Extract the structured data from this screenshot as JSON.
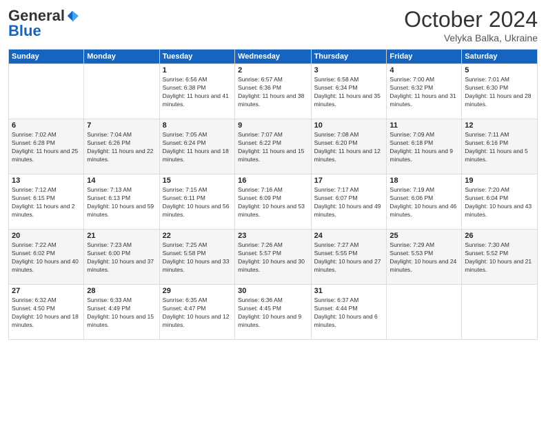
{
  "logo": {
    "general": "General",
    "blue": "Blue"
  },
  "header": {
    "month": "October 2024",
    "location": "Velyka Balka, Ukraine"
  },
  "weekdays": [
    "Sunday",
    "Monday",
    "Tuesday",
    "Wednesday",
    "Thursday",
    "Friday",
    "Saturday"
  ],
  "weeks": [
    [
      {
        "day": "",
        "info": ""
      },
      {
        "day": "",
        "info": ""
      },
      {
        "day": "1",
        "info": "Sunrise: 6:56 AM\nSunset: 6:38 PM\nDaylight: 11 hours and 41 minutes."
      },
      {
        "day": "2",
        "info": "Sunrise: 6:57 AM\nSunset: 6:36 PM\nDaylight: 11 hours and 38 minutes."
      },
      {
        "day": "3",
        "info": "Sunrise: 6:58 AM\nSunset: 6:34 PM\nDaylight: 11 hours and 35 minutes."
      },
      {
        "day": "4",
        "info": "Sunrise: 7:00 AM\nSunset: 6:32 PM\nDaylight: 11 hours and 31 minutes."
      },
      {
        "day": "5",
        "info": "Sunrise: 7:01 AM\nSunset: 6:30 PM\nDaylight: 11 hours and 28 minutes."
      }
    ],
    [
      {
        "day": "6",
        "info": "Sunrise: 7:02 AM\nSunset: 6:28 PM\nDaylight: 11 hours and 25 minutes."
      },
      {
        "day": "7",
        "info": "Sunrise: 7:04 AM\nSunset: 6:26 PM\nDaylight: 11 hours and 22 minutes."
      },
      {
        "day": "8",
        "info": "Sunrise: 7:05 AM\nSunset: 6:24 PM\nDaylight: 11 hours and 18 minutes."
      },
      {
        "day": "9",
        "info": "Sunrise: 7:07 AM\nSunset: 6:22 PM\nDaylight: 11 hours and 15 minutes."
      },
      {
        "day": "10",
        "info": "Sunrise: 7:08 AM\nSunset: 6:20 PM\nDaylight: 11 hours and 12 minutes."
      },
      {
        "day": "11",
        "info": "Sunrise: 7:09 AM\nSunset: 6:18 PM\nDaylight: 11 hours and 9 minutes."
      },
      {
        "day": "12",
        "info": "Sunrise: 7:11 AM\nSunset: 6:16 PM\nDaylight: 11 hours and 5 minutes."
      }
    ],
    [
      {
        "day": "13",
        "info": "Sunrise: 7:12 AM\nSunset: 6:15 PM\nDaylight: 11 hours and 2 minutes."
      },
      {
        "day": "14",
        "info": "Sunrise: 7:13 AM\nSunset: 6:13 PM\nDaylight: 10 hours and 59 minutes."
      },
      {
        "day": "15",
        "info": "Sunrise: 7:15 AM\nSunset: 6:11 PM\nDaylight: 10 hours and 56 minutes."
      },
      {
        "day": "16",
        "info": "Sunrise: 7:16 AM\nSunset: 6:09 PM\nDaylight: 10 hours and 53 minutes."
      },
      {
        "day": "17",
        "info": "Sunrise: 7:17 AM\nSunset: 6:07 PM\nDaylight: 10 hours and 49 minutes."
      },
      {
        "day": "18",
        "info": "Sunrise: 7:19 AM\nSunset: 6:06 PM\nDaylight: 10 hours and 46 minutes."
      },
      {
        "day": "19",
        "info": "Sunrise: 7:20 AM\nSunset: 6:04 PM\nDaylight: 10 hours and 43 minutes."
      }
    ],
    [
      {
        "day": "20",
        "info": "Sunrise: 7:22 AM\nSunset: 6:02 PM\nDaylight: 10 hours and 40 minutes."
      },
      {
        "day": "21",
        "info": "Sunrise: 7:23 AM\nSunset: 6:00 PM\nDaylight: 10 hours and 37 minutes."
      },
      {
        "day": "22",
        "info": "Sunrise: 7:25 AM\nSunset: 5:58 PM\nDaylight: 10 hours and 33 minutes."
      },
      {
        "day": "23",
        "info": "Sunrise: 7:26 AM\nSunset: 5:57 PM\nDaylight: 10 hours and 30 minutes."
      },
      {
        "day": "24",
        "info": "Sunrise: 7:27 AM\nSunset: 5:55 PM\nDaylight: 10 hours and 27 minutes."
      },
      {
        "day": "25",
        "info": "Sunrise: 7:29 AM\nSunset: 5:53 PM\nDaylight: 10 hours and 24 minutes."
      },
      {
        "day": "26",
        "info": "Sunrise: 7:30 AM\nSunset: 5:52 PM\nDaylight: 10 hours and 21 minutes."
      }
    ],
    [
      {
        "day": "27",
        "info": "Sunrise: 6:32 AM\nSunset: 4:50 PM\nDaylight: 10 hours and 18 minutes."
      },
      {
        "day": "28",
        "info": "Sunrise: 6:33 AM\nSunset: 4:49 PM\nDaylight: 10 hours and 15 minutes."
      },
      {
        "day": "29",
        "info": "Sunrise: 6:35 AM\nSunset: 4:47 PM\nDaylight: 10 hours and 12 minutes."
      },
      {
        "day": "30",
        "info": "Sunrise: 6:36 AM\nSunset: 4:45 PM\nDaylight: 10 hours and 9 minutes."
      },
      {
        "day": "31",
        "info": "Sunrise: 6:37 AM\nSunset: 4:44 PM\nDaylight: 10 hours and 6 minutes."
      },
      {
        "day": "",
        "info": ""
      },
      {
        "day": "",
        "info": ""
      }
    ]
  ]
}
